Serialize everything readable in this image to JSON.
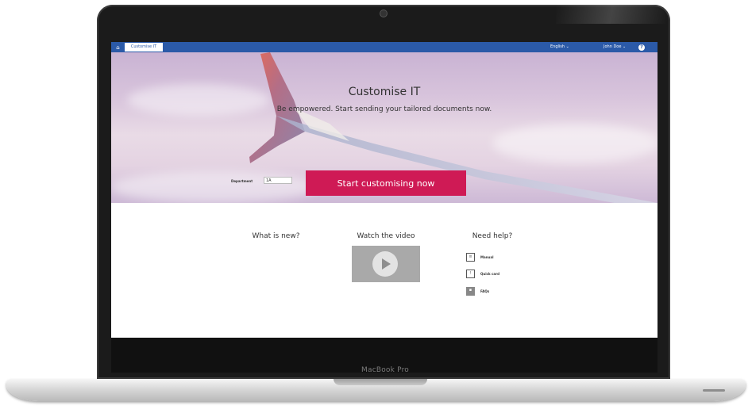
{
  "device": {
    "brand_label": "MacBook Pro"
  },
  "topbar": {
    "home_icon": "home-icon",
    "app_tab_label": "Customise IT",
    "language_label": "English ⌄",
    "user_label": "John Doe ⌄",
    "help_symbol": "?"
  },
  "hero": {
    "title": "Customise IT",
    "subtitle": "Be empowered. Start sending your tailored documents now.",
    "department_label": "Department",
    "department_value": "1A",
    "cta_label": "Start customising now"
  },
  "sections": {
    "whats_new": {
      "title": "What is new?"
    },
    "video": {
      "title": "Watch the video"
    },
    "help": {
      "title": "Need help?",
      "items": [
        {
          "label": "Manual",
          "icon": "manual-icon"
        },
        {
          "label": "Quick card",
          "icon": "quick-card-icon"
        },
        {
          "label": "FAQs",
          "icon": "faq-icon"
        }
      ]
    }
  },
  "colors": {
    "topbar": "#2b5aa8",
    "cta": "#cf1a55"
  }
}
